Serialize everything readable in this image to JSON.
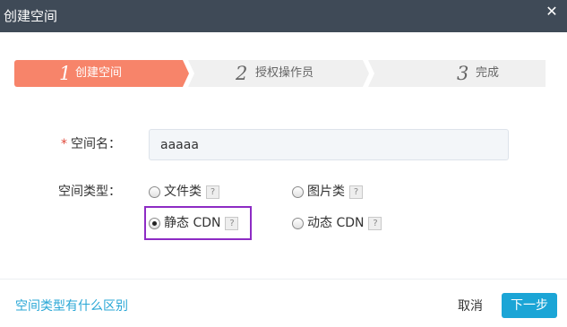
{
  "dialog": {
    "title": "创建空间",
    "close_icon": "close-icon"
  },
  "steps": [
    {
      "number": "1",
      "label": "创建空间",
      "active": true
    },
    {
      "number": "2",
      "label": "授权操作员",
      "active": false
    },
    {
      "number": "3",
      "label": "完成",
      "active": false
    }
  ],
  "form": {
    "name": {
      "required_mark": "*",
      "label": "空间名：",
      "value": "aaaaa"
    },
    "type": {
      "label": "空间类型：",
      "options": [
        {
          "label": "文件类",
          "checked": false,
          "help": "?"
        },
        {
          "label": "图片类",
          "checked": false,
          "help": "?"
        },
        {
          "label": "静态 CDN",
          "checked": true,
          "help": "?"
        },
        {
          "label": "动态 CDN",
          "checked": false,
          "help": "?"
        }
      ]
    }
  },
  "footer": {
    "help_link": "空间类型有什么区别",
    "cancel_label": "取消",
    "next_label": "下一步"
  },
  "colors": {
    "titlebar": "#3f4a57",
    "active_step": "#f7846a",
    "inactive_step": "#f0f0f0",
    "link": "#2aa7d6",
    "primary_button": "#1ba5d6",
    "highlight": "#8d2bc4",
    "required": "#e0483a"
  }
}
